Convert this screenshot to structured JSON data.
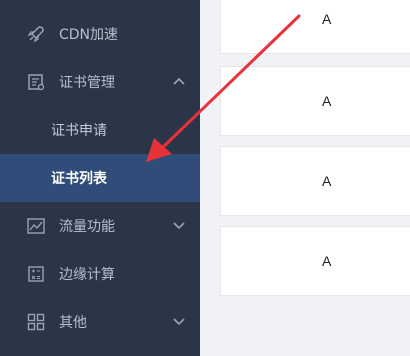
{
  "sidebar": {
    "items": [
      {
        "label": "CDN加速",
        "icon": "rocket-icon"
      },
      {
        "label": "证书管理",
        "icon": "certificate-icon",
        "expanded": true,
        "children": [
          {
            "label": "证书申请",
            "active": false
          },
          {
            "label": "证书列表",
            "active": true
          }
        ]
      },
      {
        "label": "流量功能",
        "icon": "chart-icon",
        "expanded": false
      },
      {
        "label": "边缘计算",
        "icon": "calculator-icon"
      },
      {
        "label": "其他",
        "icon": "grid-icon",
        "expanded": false
      }
    ]
  },
  "content": {
    "cards": [
      {
        "text": "A"
      },
      {
        "text": "A"
      },
      {
        "text": "A"
      },
      {
        "text": "A"
      }
    ]
  },
  "colors": {
    "sidebar_bg": "#2c3547",
    "active_bg": "#2f4d78",
    "arrow": "#e8323a"
  }
}
